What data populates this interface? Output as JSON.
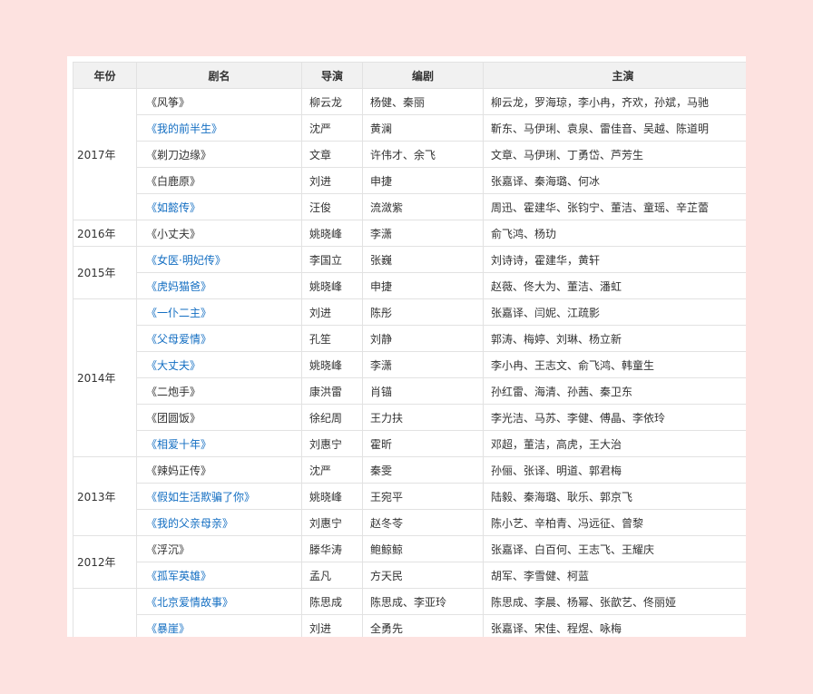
{
  "headers": {
    "year": "年份",
    "title": "剧名",
    "director": "导演",
    "writer": "编剧",
    "cast": "主演"
  },
  "rows": [
    {
      "year": "2017年",
      "span": 5,
      "title": "《风筝》",
      "link": false,
      "director": "柳云龙",
      "writer": "杨健、秦丽",
      "cast": "柳云龙，罗海琼，李小冉，齐欢，孙斌，马驰"
    },
    {
      "title": "《我的前半生》",
      "link": true,
      "director": "沈严",
      "writer": "黄澜",
      "cast": "靳东、马伊琍、袁泉、雷佳音、吴越、陈道明"
    },
    {
      "title": "《剃刀边缘》",
      "link": false,
      "director": "文章",
      "writer": "许伟才、余飞",
      "cast": "文章、马伊琍、丁勇岱、芦芳生"
    },
    {
      "title": "《白鹿原》",
      "link": false,
      "director": "刘进",
      "writer": "申捷",
      "cast": "张嘉译、秦海璐、何冰"
    },
    {
      "title": "《如懿传》",
      "link": true,
      "director": "汪俊",
      "writer": "流潋紫",
      "cast": "周迅、霍建华、张钧宁、董洁、童瑶、辛芷蕾"
    },
    {
      "year": "2016年",
      "span": 1,
      "title": "《小丈夫》",
      "link": false,
      "director": "姚晓峰",
      "writer": "李潇",
      "cast": "俞飞鸿、杨玏"
    },
    {
      "year": "2015年",
      "span": 2,
      "title": "《女医·明妃传》",
      "link": true,
      "director": "李国立",
      "writer": "张巍",
      "cast": "刘诗诗，霍建华，黄轩"
    },
    {
      "title": "《虎妈猫爸》",
      "link": true,
      "director": "姚晓峰",
      "writer": "申捷",
      "cast": "赵薇、佟大为、董洁、潘虹"
    },
    {
      "year": "2014年",
      "span": 6,
      "title": "《一仆二主》",
      "link": true,
      "director": "刘进",
      "writer": "陈彤",
      "cast": "张嘉译、闫妮、江疏影"
    },
    {
      "title": "《父母爱情》",
      "link": true,
      "director": "孔笙",
      "writer": "刘静",
      "cast": "郭涛、梅婷、刘琳、杨立新"
    },
    {
      "title": "《大丈夫》",
      "link": true,
      "director": "姚晓峰",
      "writer": "李潇",
      "cast": "李小冉、王志文、俞飞鸿、韩童生"
    },
    {
      "title": "《二炮手》",
      "link": false,
      "director": "康洪雷",
      "writer": "肖锚",
      "cast": "孙红雷、海清、孙茜、秦卫东"
    },
    {
      "title": "《团圆饭》",
      "link": false,
      "director": "徐纪周",
      "writer": "王力扶",
      "cast": "李光洁、马苏、李健、傅晶、李依玲"
    },
    {
      "title": "《相爱十年》",
      "link": true,
      "director": "刘惠宁",
      "writer": "霍昕",
      "cast": "邓超，董洁，高虎，王大治"
    },
    {
      "year": "2013年",
      "span": 3,
      "title": "《辣妈正传》",
      "link": false,
      "director": "沈严",
      "writer": "秦雯",
      "cast": "孙俪、张译、明道、郭君梅"
    },
    {
      "title": "《假如生活欺骗了你》",
      "link": true,
      "director": "姚晓峰",
      "writer": "王宛平",
      "cast": "陆毅、秦海璐、耿乐、郭京飞"
    },
    {
      "title": "《我的父亲母亲》",
      "link": true,
      "director": "刘惠宁",
      "writer": "赵冬苓",
      "cast": "陈小艺、辛柏青、冯远征、曾黎"
    },
    {
      "year": "2012年",
      "span": 2,
      "title": "《浮沉》",
      "link": false,
      "director": "滕华涛",
      "writer": "鲍鲸鲸",
      "cast": "张嘉译、白百何、王志飞、王耀庆"
    },
    {
      "title": "《孤军英雄》",
      "link": true,
      "director": "孟凡",
      "writer": "方天民",
      "cast": "胡军、李雪健、柯蓝"
    },
    {
      "year": "",
      "span": 2,
      "title": "《北京爱情故事》",
      "link": true,
      "director": "陈思成",
      "writer": "陈思成、李亚玲",
      "cast": "陈思成、李晨、杨幂、张歆艺、佟丽娅"
    },
    {
      "title": "《暴崖》",
      "link": true,
      "director": "刘进",
      "writer": "全勇先",
      "cast": "张嘉译、宋佳、程煜、咏梅"
    }
  ]
}
